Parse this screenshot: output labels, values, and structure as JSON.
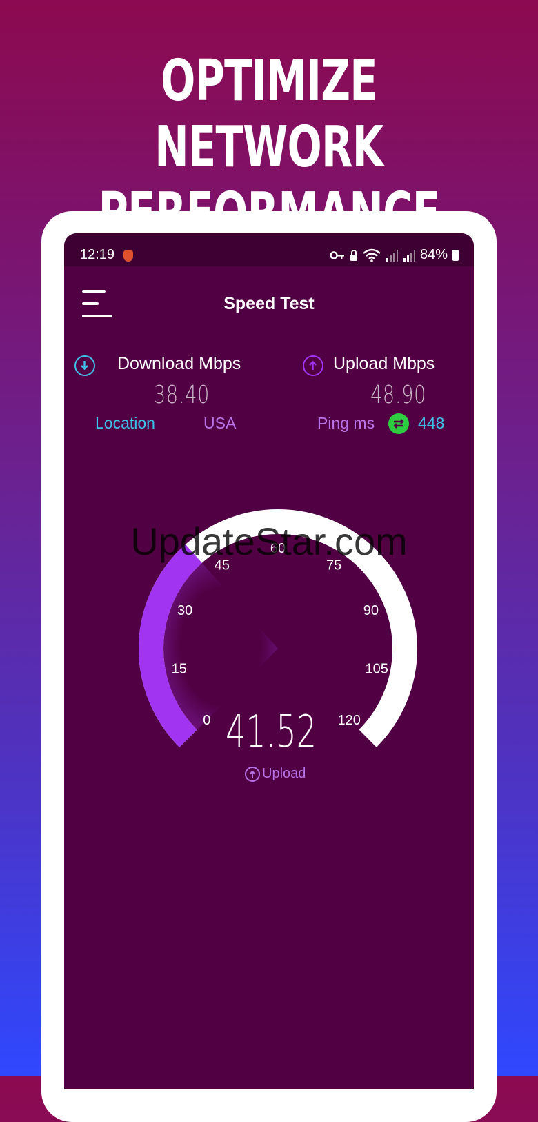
{
  "promo": {
    "headline_line1": "OPTIMIZE NETWORK",
    "headline_line2": "PERFORMANCE"
  },
  "status_bar": {
    "time": "12:19",
    "battery": "84%",
    "icons": [
      "shield-icon",
      "key-icon",
      "lock-icon",
      "wifi-icon",
      "signal-icon",
      "signal-icon",
      "battery-icon"
    ]
  },
  "header": {
    "title": "Speed Test",
    "menu_icon": "menu-icon"
  },
  "stats": {
    "download_label": "Download Mbps",
    "download_value": "38.40",
    "upload_label": "Upload Mbps",
    "upload_value": "48.90",
    "location_label": "Location",
    "location_value": "USA",
    "ping_label": "Ping ms",
    "ping_value": "448"
  },
  "gauge": {
    "ticks": [
      "0",
      "15",
      "30",
      "45",
      "60",
      "75",
      "90",
      "105",
      "120"
    ],
    "min": 0,
    "max": 120,
    "current_value": 41.52,
    "current_label": "41.52",
    "mode_label": "Upload"
  },
  "colors": {
    "background_top": "#8c0a4f",
    "background_bottom": "#2f48ff",
    "screen_bg": "#520044",
    "accent_purple": "#a034f0",
    "accent_cyan": "#3fc1ea",
    "accent_green": "#2ecc40"
  },
  "watermark": "UpdateStar.com"
}
